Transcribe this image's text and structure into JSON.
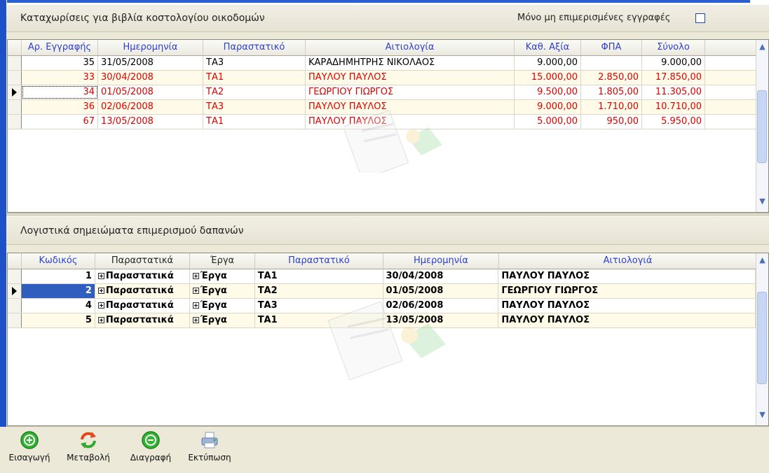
{
  "top_panel": {
    "title": "Καταχωρίσεις για βιβλία κοστολογίου οικοδομών",
    "filter_label": "Μόνο μη επιμερισμένες εγγραφές",
    "filter_checked": false,
    "columns": [
      "Αρ. Εγγραφής",
      "Ημερομηνία",
      "Παραστατικό",
      "Αιτιολογία",
      "Καθ. Αξία",
      "ΦΠΑ",
      "Σύνολο"
    ],
    "rows": [
      {
        "no": "35",
        "date": "31/05/2008",
        "doc": "ΤΑ3",
        "desc": "ΚΑΡΑΔΗΜΗΤΡΗΣ ΝΙΚΟΛΑΟΣ",
        "net": "9.000,00",
        "vat": "",
        "total": "9.000,00",
        "red": false
      },
      {
        "no": "33",
        "date": "30/04/2008",
        "doc": "ΤΑ1",
        "desc": "ΠΑΥΛΟΥ ΠΑΥΛΟΣ",
        "net": "15.000,00",
        "vat": "2.850,00",
        "total": "17.850,00",
        "red": true
      },
      {
        "no": "34",
        "date": "01/05/2008",
        "doc": "ΤΑ2",
        "desc": "ΓΕΩΡΓΙΟΥ ΓΙΩΡΓΟΣ",
        "net": "9.500,00",
        "vat": "1.805,00",
        "total": "11.305,00",
        "red": true
      },
      {
        "no": "36",
        "date": "02/06/2008",
        "doc": "ΤΑ3",
        "desc": "ΠΑΥΛΟΥ ΠΑΥΛΟΣ",
        "net": "9.000,00",
        "vat": "1.710,00",
        "total": "10.710,00",
        "red": true
      },
      {
        "no": "67",
        "date": "13/05/2008",
        "doc": "ΤΑ1",
        "desc": "ΠΑΥΛΟΥ ΠΑΥΛΟΣ",
        "net": "5.000,00",
        "vat": "950,00",
        "total": "5.950,00",
        "red": true
      }
    ],
    "current_row": 2
  },
  "bottom_panel": {
    "title": "Λογιστικά σημειώματα επιμερισμού δαπανών",
    "columns": [
      "Κωδικός",
      "Παραστατικά",
      "Έργα",
      "Παραστατικό",
      "Ημερομηνία",
      "Αιτιολογιά"
    ],
    "rows": [
      {
        "code": "1",
        "docs": "Παραστατικά",
        "works": "Έργα",
        "doc": "ΤΑ1",
        "date": "30/04/2008",
        "desc": "ΠΑΥΛΟΥ ΠΑΥΛΟΣ"
      },
      {
        "code": "2",
        "docs": "Παραστατικά",
        "works": "Έργα",
        "doc": "ΤΑ2",
        "date": "01/05/2008",
        "desc": "ΓΕΩΡΓΙΟΥ ΓΙΩΡΓΟΣ"
      },
      {
        "code": "4",
        "docs": "Παραστατικά",
        "works": "Έργα",
        "doc": "ΤΑ3",
        "date": "02/06/2008",
        "desc": "ΠΑΥΛΟΥ ΠΑΥΛΟΣ"
      },
      {
        "code": "5",
        "docs": "Παραστατικά",
        "works": "Έργα",
        "doc": "ΤΑ1",
        "date": "13/05/2008",
        "desc": "ΠΑΥΛΟΥ ΠΑΥΛΟΣ"
      }
    ],
    "current_row": 1
  },
  "toolbar": {
    "insert_label": "Εισαγωγή",
    "edit_label": "Μεταβολή",
    "delete_label": "Διαγραφή",
    "print_label": "Εκτύπωση"
  },
  "colors": {
    "accent_blue": "#2f5ec0",
    "red_text": "#e00000",
    "header_text": "#2b3fd0",
    "insert_green": "#2fae2f"
  },
  "icons": {
    "insert": "plus-circle-icon",
    "edit": "refresh-arrows-icon",
    "delete": "minus-circle-icon",
    "print": "printer-icon"
  }
}
